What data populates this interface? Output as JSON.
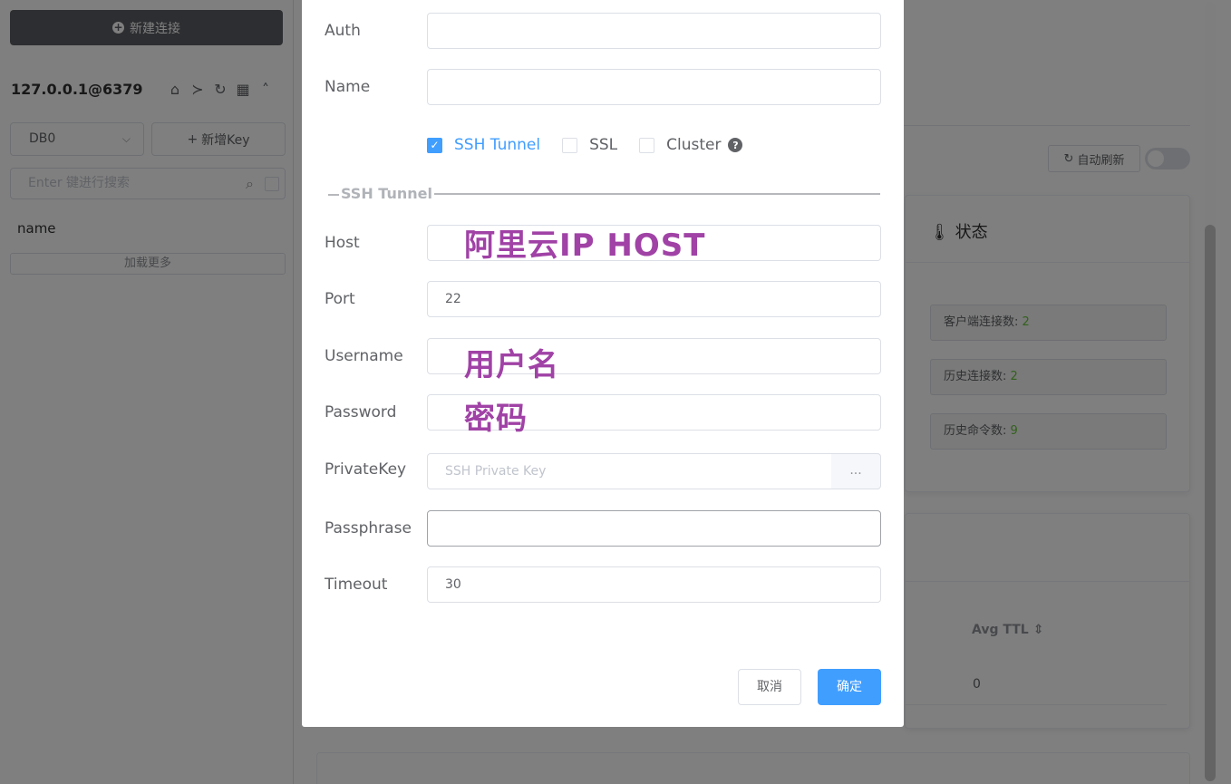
{
  "sidebar": {
    "new_connection_label": "新建连接",
    "connection_title": "127.0.0.1@6379",
    "db_selected": "DB0",
    "add_key_label": "新增Key",
    "search_placeholder": "Enter 键进行搜索",
    "key_items": [
      "name"
    ],
    "load_more_label": "加载更多"
  },
  "main": {
    "auto_refresh_label": "自动刷新",
    "status_title": "状态",
    "stats": [
      {
        "label": "客户端连接数:",
        "value": "2"
      },
      {
        "label": "历史连接数:",
        "value": "2"
      },
      {
        "label": "历史命令数:",
        "value": "9"
      }
    ],
    "table": {
      "column": "Avg TTL",
      "value": "0"
    }
  },
  "dialog": {
    "fields": {
      "auth": {
        "label": "Auth",
        "value": ""
      },
      "name": {
        "label": "Name",
        "value": ""
      }
    },
    "options": [
      {
        "label": "SSH Tunnel",
        "checked": true
      },
      {
        "label": "SSL",
        "checked": false
      },
      {
        "label": "Cluster",
        "checked": false
      }
    ],
    "ssh_section_title": "SSH Tunnel",
    "ssh": {
      "host": {
        "label": "Host",
        "value": "",
        "annotation": "阿里云IP HOST"
      },
      "port": {
        "label": "Port",
        "value": "22"
      },
      "username": {
        "label": "Username",
        "value": "",
        "annotation": "用户名"
      },
      "password": {
        "label": "Password",
        "value": "",
        "annotation": "密码"
      },
      "private_key": {
        "label": "PrivateKey",
        "placeholder": "SSH Private Key",
        "button": "..."
      },
      "passphrase": {
        "label": "Passphrase",
        "value": ""
      },
      "timeout": {
        "label": "Timeout",
        "value": "30"
      }
    },
    "cancel_label": "取消",
    "confirm_label": "确定"
  },
  "colors": {
    "primary": "#409eff",
    "annotation": "#a042a6",
    "success": "#67c23a"
  }
}
